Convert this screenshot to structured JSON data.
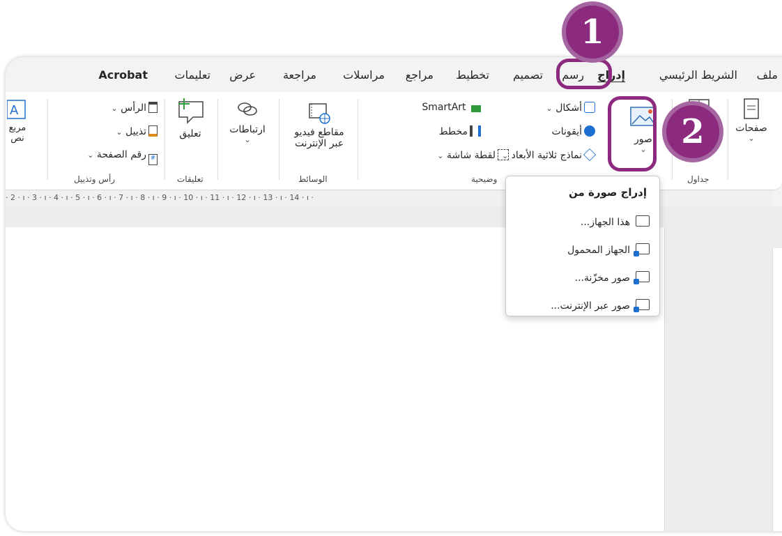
{
  "tabs": [
    {
      "label": "ملف",
      "active": false
    },
    {
      "label": "الشريط الرئيسي",
      "active": false
    },
    {
      "label": "إدراج",
      "active": true
    },
    {
      "label": "رسم",
      "active": false
    },
    {
      "label": "تصميم",
      "active": false
    },
    {
      "label": "تخطيط",
      "active": false
    },
    {
      "label": "مراجع",
      "active": false
    },
    {
      "label": "مراسلات",
      "active": false
    },
    {
      "label": "مراجعة",
      "active": false
    },
    {
      "label": "عرض",
      "active": false
    },
    {
      "label": "تعليمات",
      "active": false
    },
    {
      "label": "Acrobat",
      "active": false
    }
  ],
  "ribbon": {
    "pages_label": "صفحات",
    "tables_group": "جداول",
    "pictures_label": "صور",
    "shapes_label": "أشكال",
    "icons_label": "أيقونات",
    "models3d_label": "نماذج ثلاثية الأبعاد",
    "smartart_label": "SmartArt",
    "chart_label": "مخطط",
    "screenshot_label": "لقطة شاشة",
    "illustrations_group": "وضيحية",
    "online_video_line1": "مقاطع فيديو",
    "online_video_line2": "عبر الإنترنت",
    "media_group": "الوسائط",
    "links_label": "ارتباطات",
    "comment_label": "تعليق",
    "comments_group": "تعليقات",
    "header_label": "الرأس",
    "footer_label": "تذييل",
    "page_number_label": "رقم الصفحة",
    "header_footer_group": "رأس وتذييل",
    "textbox_line1": "مربع",
    "textbox_line2": "نص"
  },
  "ruler_text": "· 2 · ı · 3 · ı · 4 · ı · 5 · ı · 6 · ı · 7 · ı · 8 · ı · 9 · ı · 10 · ı · 11 · ı · 12 · ı · 13 · ı · 14 · ı ·",
  "menu": {
    "title": "إدراج صورة من",
    "items": [
      "هذا الجهاز...",
      "الجهاز المحمول",
      "صور مخزّنة...",
      "صور عبر الإنترنت..."
    ]
  },
  "badges": [
    "1",
    "2"
  ],
  "colors": {
    "accent": "#8b2a7e",
    "icon_blue": "#1f6fd1",
    "icon_green": "#2e9a3c"
  }
}
